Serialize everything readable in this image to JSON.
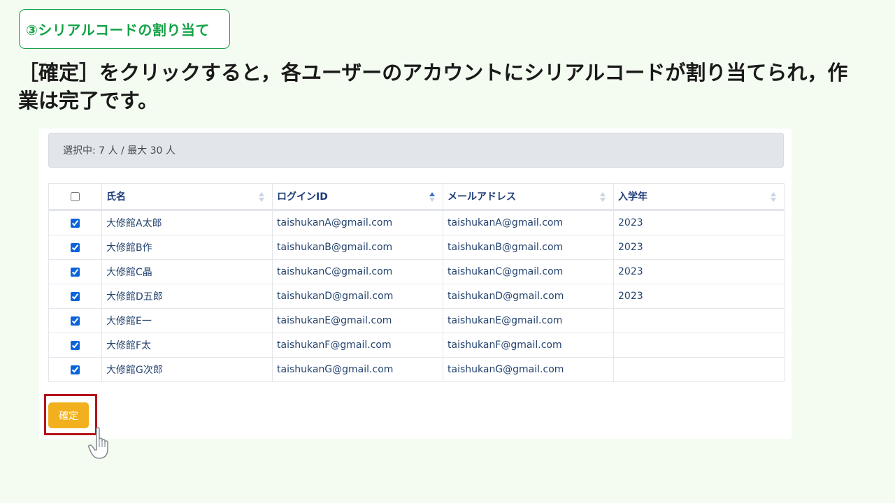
{
  "header": {
    "step_label": "③シリアルコードの割り当て",
    "instruction": "［確定］をクリックすると，各ユーザーのアカウントにシリアルコードが割り当てられ，作業は完了です。"
  },
  "selection_status": "選択中: 7 人 / 最大 30 人",
  "table": {
    "columns": [
      "氏名",
      "ログインID",
      "メールアドレス",
      "入学年"
    ],
    "rows": [
      {
        "checked": true,
        "name": "大修館A太郎",
        "login_id": "taishukanA@gmail.com",
        "email": "taishukanA@gmail.com",
        "year": "2023"
      },
      {
        "checked": true,
        "name": "大修館B作",
        "login_id": "taishukanB@gmail.com",
        "email": "taishukanB@gmail.com",
        "year": "2023"
      },
      {
        "checked": true,
        "name": "大修館C晶",
        "login_id": "taishukanC@gmail.com",
        "email": "taishukanC@gmail.com",
        "year": "2023"
      },
      {
        "checked": true,
        "name": "大修館D五郎",
        "login_id": "taishukanD@gmail.com",
        "email": "taishukanD@gmail.com",
        "year": "2023"
      },
      {
        "checked": true,
        "name": "大修館E一",
        "login_id": "taishukanE@gmail.com",
        "email": "taishukanE@gmail.com",
        "year": ""
      },
      {
        "checked": true,
        "name": "大修館F太",
        "login_id": "taishukanF@gmail.com",
        "email": "taishukanF@gmail.com",
        "year": ""
      },
      {
        "checked": true,
        "name": "大修館G次郎",
        "login_id": "taishukanG@gmail.com",
        "email": "taishukanG@gmail.com",
        "year": ""
      }
    ]
  },
  "confirm_button_label": "確定",
  "colors": {
    "page_background": "#f4fcf1",
    "step_label": "#14a346",
    "header_text": "#1e3c78",
    "confirm_button": "#f2b01e",
    "highlight": "#b5121b",
    "active_sort": "#3b6fc9",
    "inactive_sort": "#c9d3e2"
  },
  "icons": {
    "sort_inactive": "sort-both-icon",
    "sort_active": "sort-ascending-icon",
    "pointer": "pointing-hand-icon"
  }
}
